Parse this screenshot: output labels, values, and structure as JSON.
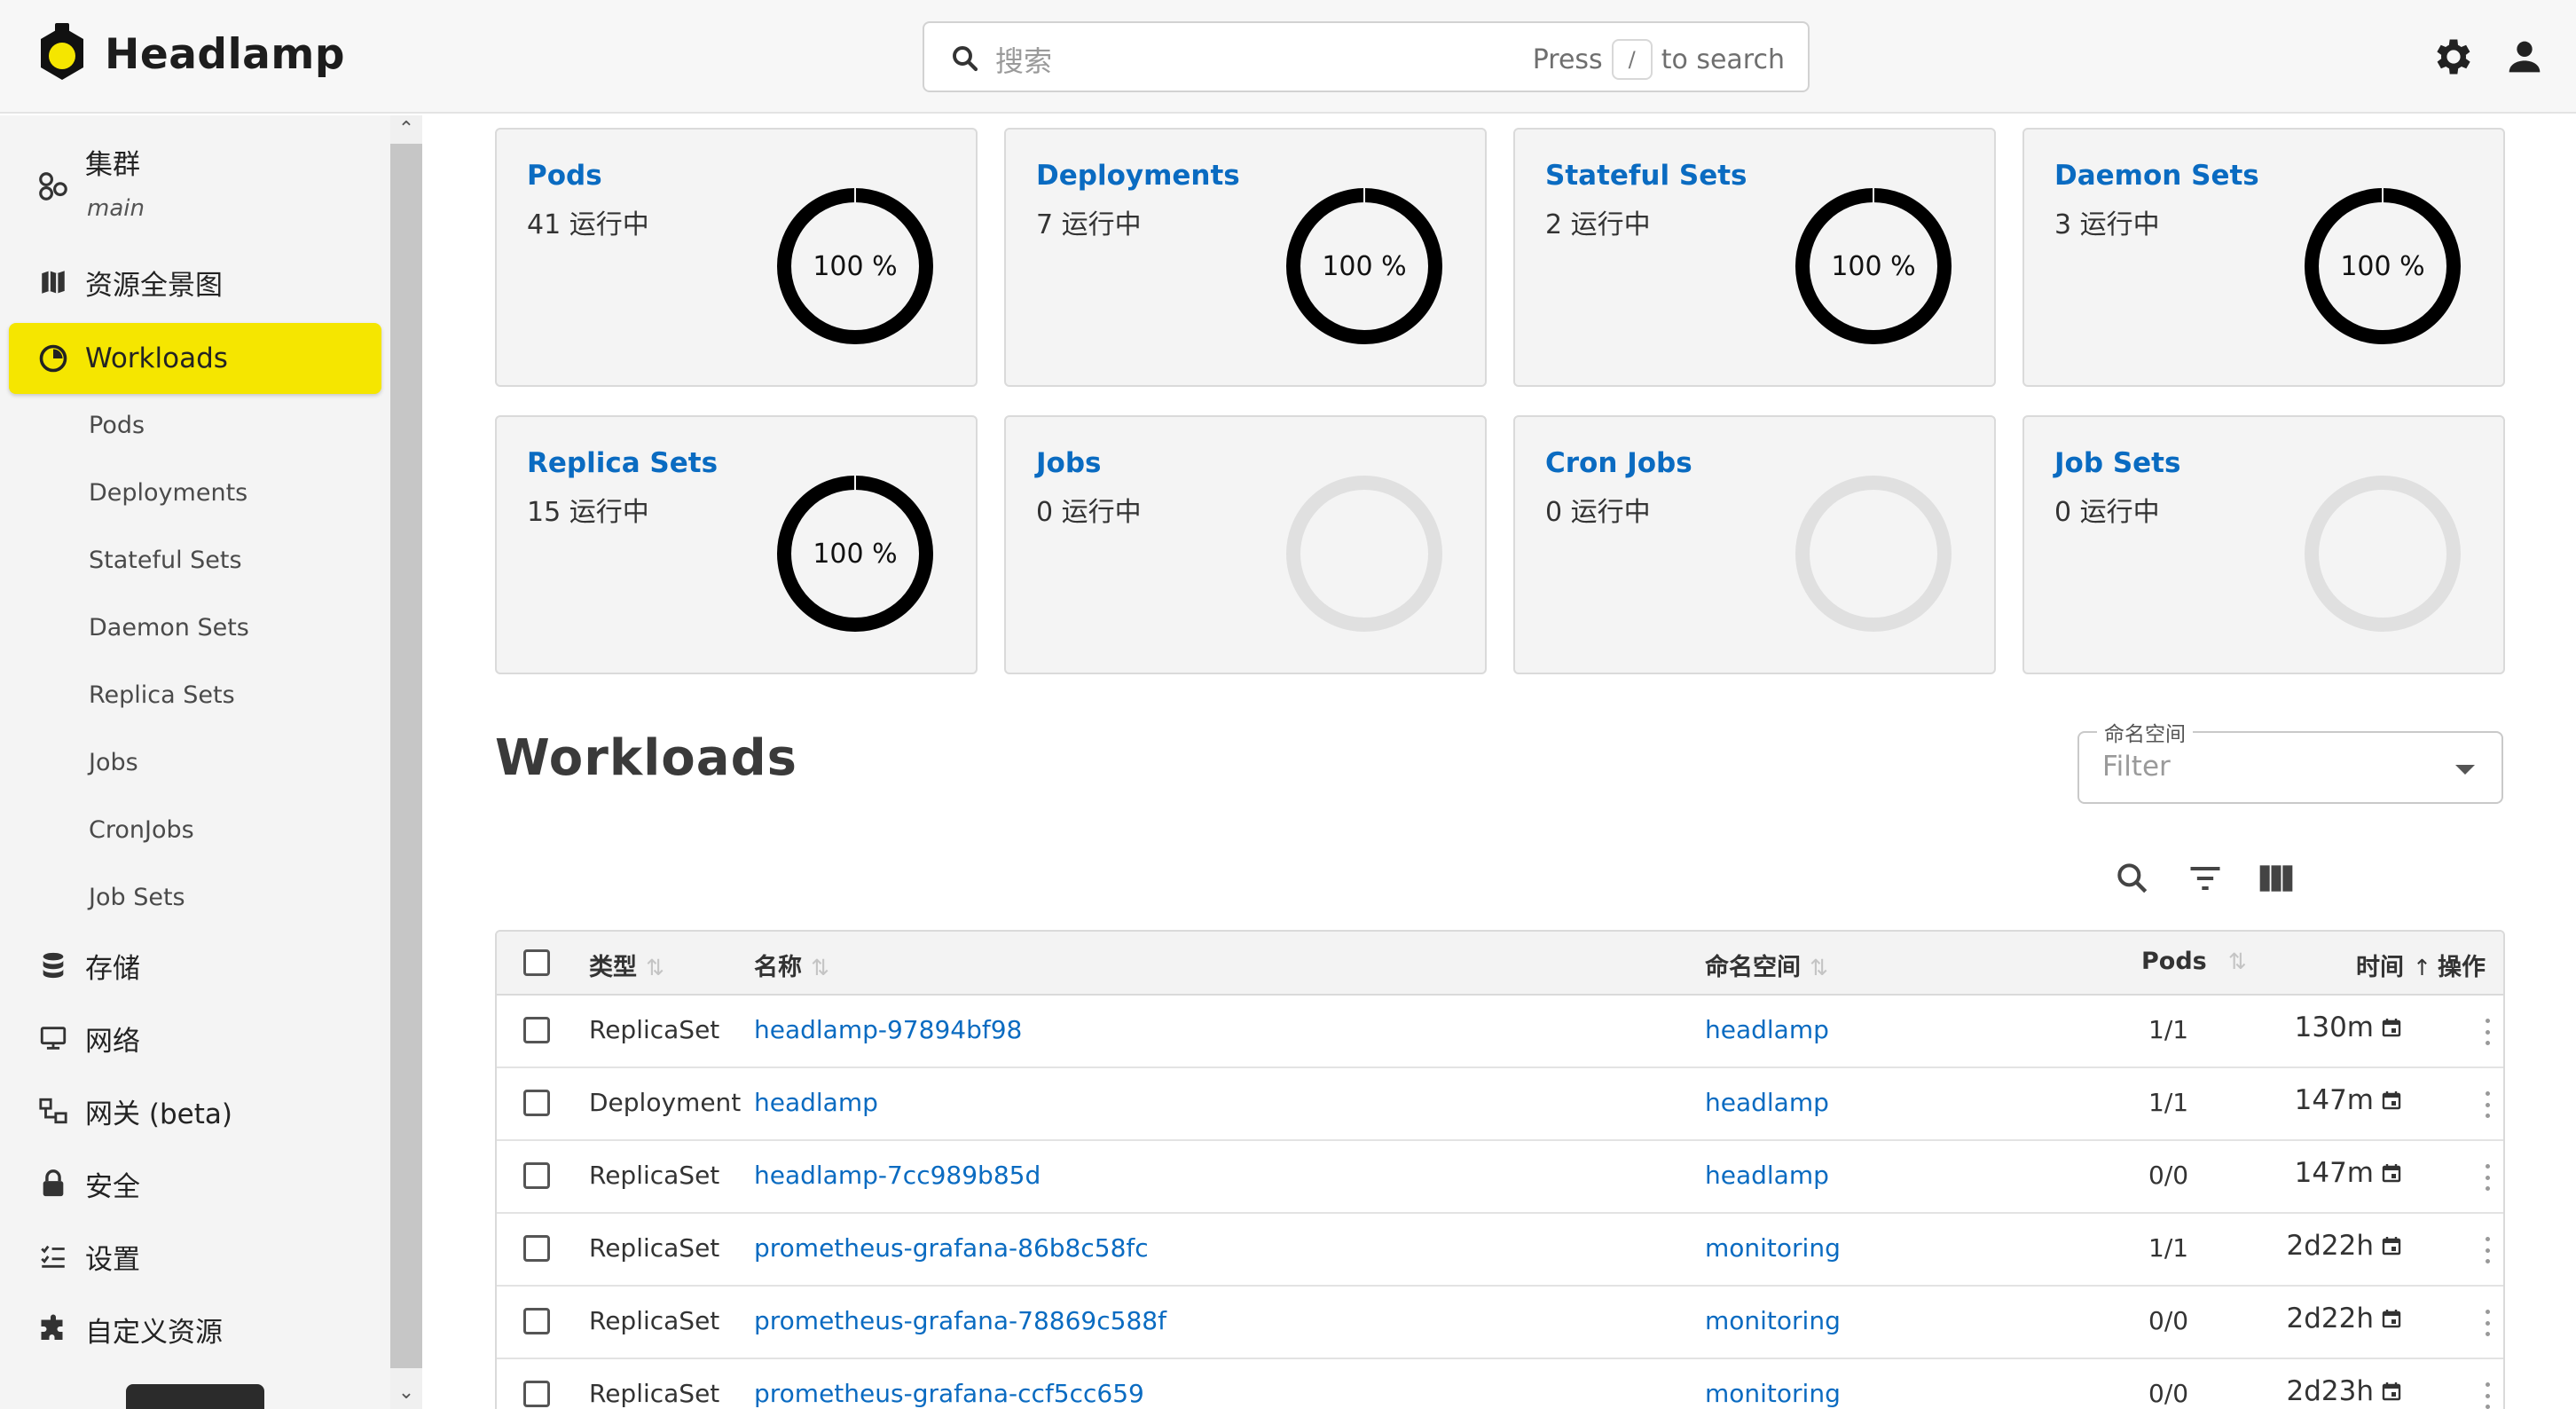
{
  "app": {
    "title": "Headlamp"
  },
  "search": {
    "placeholder": "搜索",
    "hint_press": "Press",
    "hint_key": "/",
    "hint_suffix": "to search"
  },
  "topbar": {
    "settings_icon": "gear-icon",
    "account_icon": "person-icon"
  },
  "sidebar": {
    "cluster": {
      "label": "集群",
      "name": "main"
    },
    "items": [
      {
        "label": "资源全景图",
        "icon": "map-icon"
      },
      {
        "label": "Workloads",
        "icon": "pie-icon",
        "active": true
      },
      {
        "label": "存储",
        "icon": "database-icon"
      },
      {
        "label": "网络",
        "icon": "network-icon"
      },
      {
        "label": "网关 (beta)",
        "icon": "gateway-icon"
      },
      {
        "label": "安全",
        "icon": "lock-icon"
      },
      {
        "label": "设置",
        "icon": "checklist-icon"
      },
      {
        "label": "自定义资源",
        "icon": "puzzle-icon"
      }
    ],
    "sub_items": [
      "Pods",
      "Deployments",
      "Stateful Sets",
      "Daemon Sets",
      "Replica Sets",
      "Jobs",
      "CronJobs",
      "Job Sets"
    ]
  },
  "cards": [
    {
      "title": "Pods",
      "count": "41 运行中",
      "percent_label": "100 %",
      "fraction": 1
    },
    {
      "title": "Deployments",
      "count": "7 运行中",
      "percent_label": "100 %",
      "fraction": 1
    },
    {
      "title": "Stateful Sets",
      "count": "2 运行中",
      "percent_label": "100 %",
      "fraction": 1
    },
    {
      "title": "Daemon Sets",
      "count": "3 运行中",
      "percent_label": "100 %",
      "fraction": 1
    },
    {
      "title": "Replica Sets",
      "count": "15 运行中",
      "percent_label": "100 %",
      "fraction": 1
    },
    {
      "title": "Jobs",
      "count": "0 运行中",
      "percent_label": "",
      "fraction": 0
    },
    {
      "title": "Cron Jobs",
      "count": "0 运行中",
      "percent_label": "",
      "fraction": 0
    },
    {
      "title": "Job Sets",
      "count": "0 运行中",
      "percent_label": "",
      "fraction": 0
    }
  ],
  "workloads": {
    "title": "Workloads",
    "namespace_filter": {
      "label": "命名空间",
      "placeholder": "Filter"
    },
    "columns": {
      "type": "类型",
      "name": "名称",
      "namespace": "命名空间",
      "pods": "Pods",
      "age": "时间",
      "actions": "操作"
    },
    "rows": [
      {
        "type": "ReplicaSet",
        "name": "headlamp-97894bf98",
        "namespace": "headlamp",
        "pods": "1/1",
        "age": "130m"
      },
      {
        "type": "Deployment",
        "name": "headlamp",
        "namespace": "headlamp",
        "pods": "1/1",
        "age": "147m"
      },
      {
        "type": "ReplicaSet",
        "name": "headlamp-7cc989b85d",
        "namespace": "headlamp",
        "pods": "0/0",
        "age": "147m"
      },
      {
        "type": "ReplicaSet",
        "name": "prometheus-grafana-86b8c58fc",
        "namespace": "monitoring",
        "pods": "1/1",
        "age": "2d22h"
      },
      {
        "type": "ReplicaSet",
        "name": "prometheus-grafana-78869c588f",
        "namespace": "monitoring",
        "pods": "0/0",
        "age": "2d22h"
      },
      {
        "type": "ReplicaSet",
        "name": "prometheus-grafana-ccf5cc659",
        "namespace": "monitoring",
        "pods": "0/0",
        "age": "2d23h"
      }
    ]
  },
  "colors": {
    "accent_yellow": "#f5e600",
    "link_blue": "#0a6bc1",
    "ring_black": "#000000",
    "ring_empty": "#e0e0e0"
  }
}
